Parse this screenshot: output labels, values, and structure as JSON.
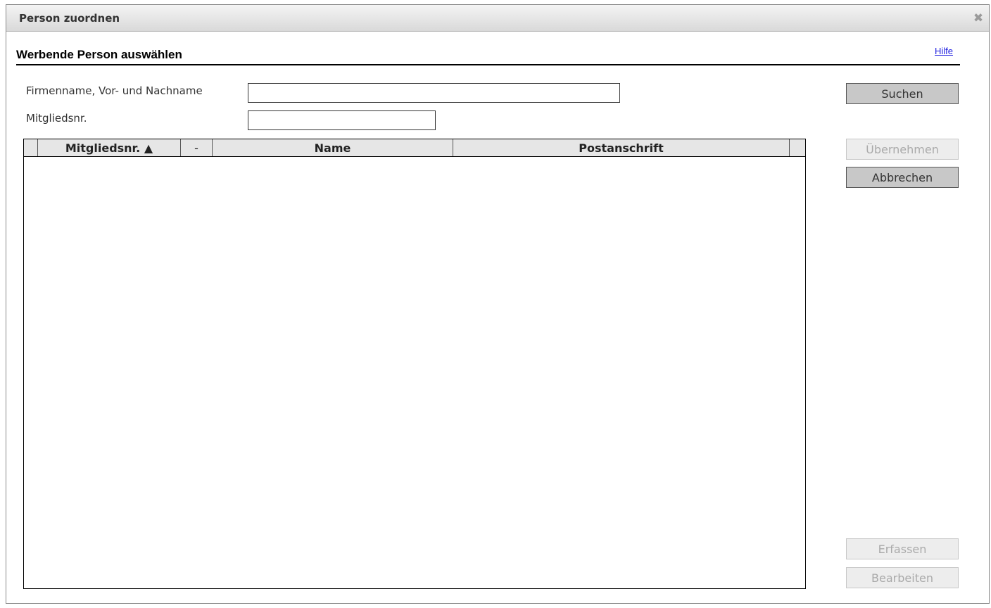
{
  "dialog": {
    "title": "Person zuordnen",
    "close_glyph": "✖"
  },
  "section": {
    "title": "Werbende Person auswählen",
    "help_link": "Hilfe"
  },
  "form": {
    "name_label": "Firmenname, Vor- und Nachname",
    "name_value": "",
    "member_label": "Mitgliedsnr.",
    "member_value": ""
  },
  "table": {
    "columns": [
      "",
      "Mitgliedsnr. ▲",
      "-",
      "Name",
      "Postanschrift",
      ""
    ],
    "rows": []
  },
  "buttons": {
    "search": "Suchen",
    "accept": "Übernehmen",
    "cancel": "Abbrechen",
    "create": "Erfassen",
    "edit": "Bearbeiten"
  },
  "icons": {
    "close": "close-icon"
  }
}
